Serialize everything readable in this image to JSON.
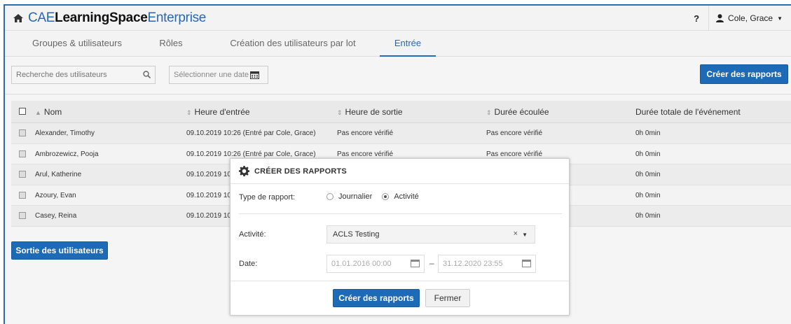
{
  "app": {
    "brand_cae": "CAE",
    "brand_ls": "LearningSpace",
    "brand_ent": "Enterprise",
    "help": "?",
    "user": "Cole, Grace"
  },
  "tabs": [
    {
      "label": "Groupes & utilisateurs"
    },
    {
      "label": "Rôles"
    },
    {
      "label": "Création des utilisateurs par lot"
    },
    {
      "label": "Entrée",
      "active": true
    }
  ],
  "toolbar": {
    "search_placeholder": "Recherche des utilisateurs",
    "date_placeholder": "Sélectionner une date",
    "create_reports": "Créer des rapports"
  },
  "table": {
    "headers": [
      "Nom",
      "Heure d'entrée",
      "Heure de sortie",
      "Durée écoulée",
      "Durée totale de l'événement"
    ],
    "rows": [
      {
        "name": "Alexander, Timothy",
        "entry": "09.10.2019 10:26 (Entré par Cole, Grace)",
        "exit": "Pas encore vérifié",
        "elapsed": "Pas encore vérifié",
        "total": "0h 0min"
      },
      {
        "name": "Ambrozewicz, Pooja",
        "entry": "09.10.2019 10:26 (Entré par Cole, Grace)",
        "exit": "Pas encore vérifié",
        "elapsed": "Pas encore vérifié",
        "total": "0h 0min"
      },
      {
        "name": "Arul, Katherine",
        "entry": "09.10.2019 10:",
        "exit": "",
        "elapsed": "",
        "total": "0h 0min"
      },
      {
        "name": "Azoury, Evan",
        "entry": "09.10.2019 10:",
        "exit": "",
        "elapsed": "",
        "total": "0h 0min"
      },
      {
        "name": "Casey, Reina",
        "entry": "09.10.2019 10:",
        "exit": "",
        "elapsed": "",
        "total": "0h 0min"
      }
    ]
  },
  "exit_users": "Sortie des utilisateurs",
  "modal": {
    "title": "CRÉER DES RAPPORTS",
    "type_label": "Type de rapport:",
    "opt_daily": "Journalier",
    "opt_activity": "Activité",
    "selected": "Activité",
    "activity_label": "Activité:",
    "activity_value": "ACLS Testing",
    "clear": "×",
    "date_label": "Date:",
    "date_from": "01.01.2016 00:00",
    "date_sep": "–",
    "date_to": "31.12.2020 23:55",
    "create": "Créer des rapports",
    "close": "Fermer"
  },
  "colors": {
    "accent": "#1d6ab7",
    "brand_blue": "#2a66b8"
  }
}
